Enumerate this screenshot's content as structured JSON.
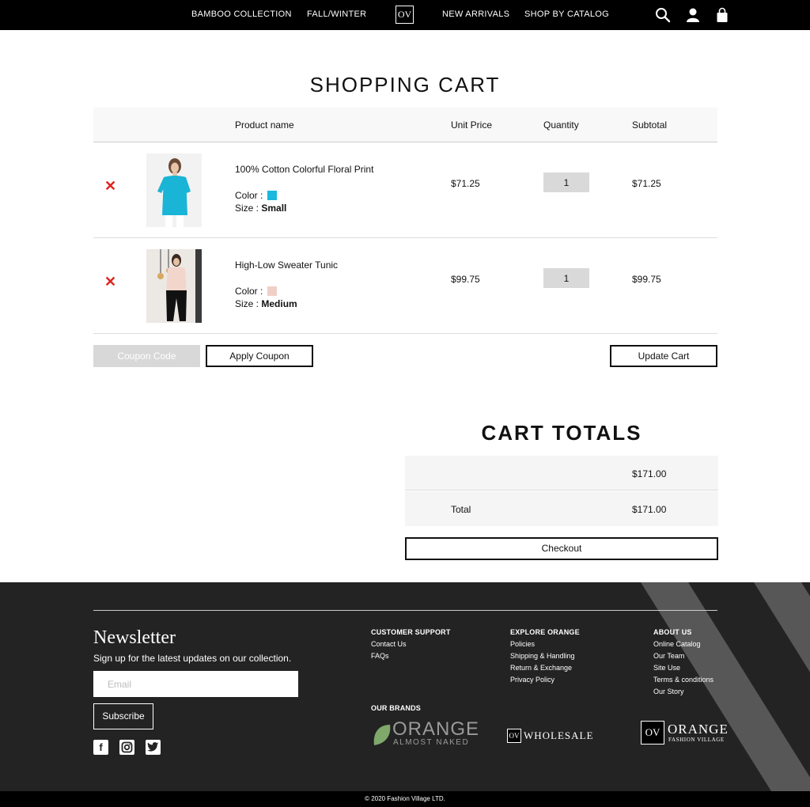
{
  "nav": {
    "links": [
      "BAMBOO COLLECTION",
      "FALL/WINTER",
      "NEW ARRIVALS",
      "SHOP BY CATALOG"
    ],
    "logo_text": "OV",
    "icons": [
      "search-icon",
      "user-icon",
      "shopping-bag-icon"
    ]
  },
  "cart": {
    "title": "SHOPPING CART",
    "headers": {
      "product": "Product name",
      "unit_price": "Unit Price",
      "quantity": "Quantity",
      "subtotal": "Subtotal"
    },
    "items": [
      {
        "name": "100% Cotton Colorful Floral Print",
        "color_label": "Color :",
        "color": "#1ab8dc",
        "size_label": "Size :",
        "size": "Small",
        "unit_price": "$71.25",
        "quantity": "1",
        "subtotal": "$71.25"
      },
      {
        "name": "High-Low Sweater Tunic",
        "color_label": "Color :",
        "color": "#f0cfc6",
        "size_label": "Size :",
        "size": "Medium",
        "unit_price": "$99.75",
        "quantity": "1",
        "subtotal": "$99.75"
      }
    ],
    "remove_symbol": "✕",
    "coupon_placeholder": "Coupon Code",
    "apply_coupon": "Apply Coupon",
    "update_cart": "Update Cart"
  },
  "totals": {
    "title": "CART TOTALS",
    "subtotal_value": "$171.00",
    "total_label": "Total",
    "total_value": "$171.00",
    "checkout": "Checkout"
  },
  "footer": {
    "newsletter_title": "Newsletter",
    "newsletter_text": "Sign up for the latest updates on our collection.",
    "email_placeholder": "Email",
    "subscribe": "Subscribe",
    "social_icons": [
      "facebook-icon",
      "instagram-icon",
      "twitter-icon"
    ],
    "columns": [
      {
        "heading": "CUSTOMER SUPPORT",
        "links": [
          "Contact Us",
          "FAQs"
        ]
      },
      {
        "heading": "EXPLORE ORANGE",
        "links": [
          "Policies",
          "Shipping & Handling",
          "Return & Exchange",
          "Privacy Policy"
        ]
      },
      {
        "heading": "ABOUT US",
        "links": [
          "Online Catalog",
          "Our Team",
          "Site Use",
          "Terms & conditions",
          "Our Story"
        ]
      }
    ],
    "brands_heading": "OUR  BRANDS",
    "brands": [
      {
        "name": "ORANGE",
        "sub": "ALMOST NAKED"
      },
      {
        "mark": "OV",
        "name": "WHOLESALE"
      },
      {
        "mark": "OV",
        "name": "ORANGE",
        "sub": "FASHION VILLAGE"
      }
    ],
    "copyright": "© 2020 Fashion Village LTD."
  },
  "colors": {
    "nav_bg": "#000000",
    "footer_bg": "#232323",
    "remove": "#e1211e",
    "qty_bg": "#d9d9d9"
  }
}
